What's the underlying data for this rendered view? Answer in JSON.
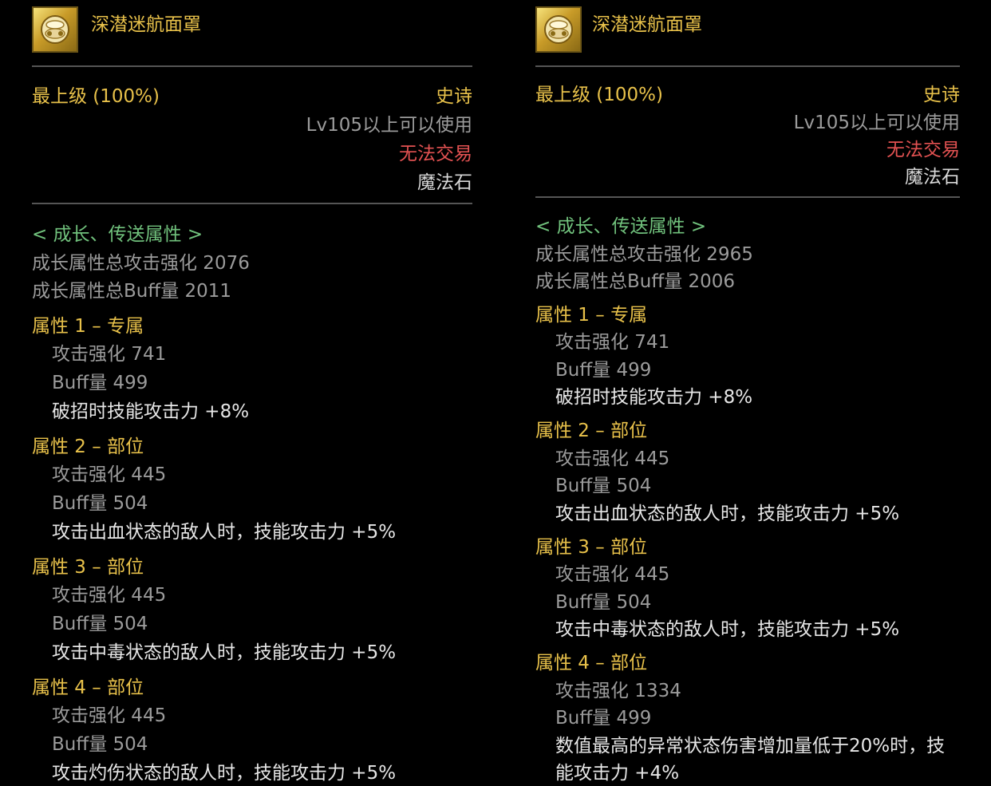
{
  "left": {
    "item_name": "深潜迷航面罩",
    "grade": "最上级 (100%)",
    "rarity": "史诗",
    "level_req": "Lv105以上可以使用",
    "trade": "无法交易",
    "kind": "魔法石",
    "section_title": "< 成长、传送属性 >",
    "total_attack": "成长属性总攻击强化 2076",
    "total_buff": "成长属性总Buff量 2011",
    "attrs": [
      {
        "title": "属性 1 – 专属",
        "attack": "攻击强化  741",
        "buff": "Buff量  499",
        "effect": "破招时技能攻击力 +8%"
      },
      {
        "title": "属性 2 – 部位",
        "attack": "攻击强化  445",
        "buff": "Buff量  504",
        "effect": "攻击出血状态的敌人时，技能攻击力 +5%"
      },
      {
        "title": "属性 3 – 部位",
        "attack": "攻击强化  445",
        "buff": "Buff量  504",
        "effect": "攻击中毒状态的敌人时，技能攻击力 +5%"
      },
      {
        "title": "属性 4 – 部位",
        "attack": "攻击强化  445",
        "buff": "Buff量  504",
        "effect": "攻击灼伤状态的敌人时，技能攻击力 +5%"
      }
    ]
  },
  "right": {
    "item_name": "深潜迷航面罩",
    "grade": "最上级 (100%)",
    "rarity": "史诗",
    "level_req": "Lv105以上可以使用",
    "trade": "无法交易",
    "kind": "魔法石",
    "section_title": "< 成长、传送属性 >",
    "total_attack": "成长属性总攻击强化 2965",
    "total_buff": "成长属性总Buff量 2006",
    "attrs": [
      {
        "title": "属性 1 – 专属",
        "attack": "攻击强化  741",
        "buff": "Buff量  499",
        "effect": "破招时技能攻击力 +8%"
      },
      {
        "title": "属性 2 – 部位",
        "attack": "攻击强化  445",
        "buff": "Buff量  504",
        "effect": "攻击出血状态的敌人时，技能攻击力 +5%"
      },
      {
        "title": "属性 3 – 部位",
        "attack": "攻击强化  445",
        "buff": "Buff量  504",
        "effect": "攻击中毒状态的敌人时，技能攻击力 +5%"
      },
      {
        "title": "属性 4 – 部位",
        "attack": "攻击强化  1334",
        "buff": "Buff量  499",
        "effect_line1": "数值最高的异常状态伤害增加量低于20%时，技",
        "effect_line2": "能攻击力 +4%"
      }
    ]
  },
  "colors": {
    "background": "#000000",
    "gold": "#e8c14a",
    "red": "#e35252",
    "green": "#71c27d",
    "gray": "#9b9b9b",
    "white": "#e6e6e6",
    "divider": "#555555"
  },
  "icons": {
    "item": "mask-item-icon"
  }
}
